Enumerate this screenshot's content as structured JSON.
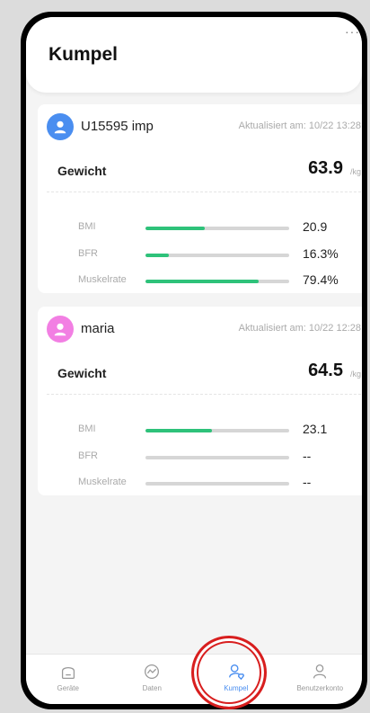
{
  "page": {
    "title": "Kumpel",
    "more_menu": "···"
  },
  "friends": [
    {
      "name": "U15595 imp",
      "updated": "Aktualisiert am: 10/22 13:28",
      "avatar_color": "#4a8ef0",
      "weight_label": "Gewicht",
      "weight_value": "63.9",
      "weight_unit": "/kg",
      "metrics": [
        {
          "label": "BMI",
          "value": "20.9",
          "fill": 0.41
        },
        {
          "label": "BFR",
          "value": "16.3%",
          "fill": 0.16
        },
        {
          "label": "Muskelrate",
          "value": "79.4%",
          "fill": 0.79
        }
      ]
    },
    {
      "name": "maria",
      "updated": "Aktualisiert am: 10/22 12:28",
      "avatar_color": "#f27fe3",
      "weight_label": "Gewicht",
      "weight_value": "64.5",
      "weight_unit": "/kg",
      "metrics": [
        {
          "label": "BMI",
          "value": "23.1",
          "fill": 0.46
        },
        {
          "label": "BFR",
          "value": "--",
          "fill": 0
        },
        {
          "label": "Muskelrate",
          "value": "--",
          "fill": 0
        }
      ]
    }
  ],
  "nav": {
    "items": [
      {
        "label": "Geräte",
        "icon": "device-icon"
      },
      {
        "label": "Daten",
        "icon": "chart-icon"
      },
      {
        "label": "Kumpel",
        "icon": "friend-icon",
        "active": true
      },
      {
        "label": "Benutzerkonto",
        "icon": "user-icon"
      }
    ],
    "active_color": "#4a8ef0",
    "bar_color": "#2ec27a",
    "highlight_color": "#d81e1e"
  }
}
